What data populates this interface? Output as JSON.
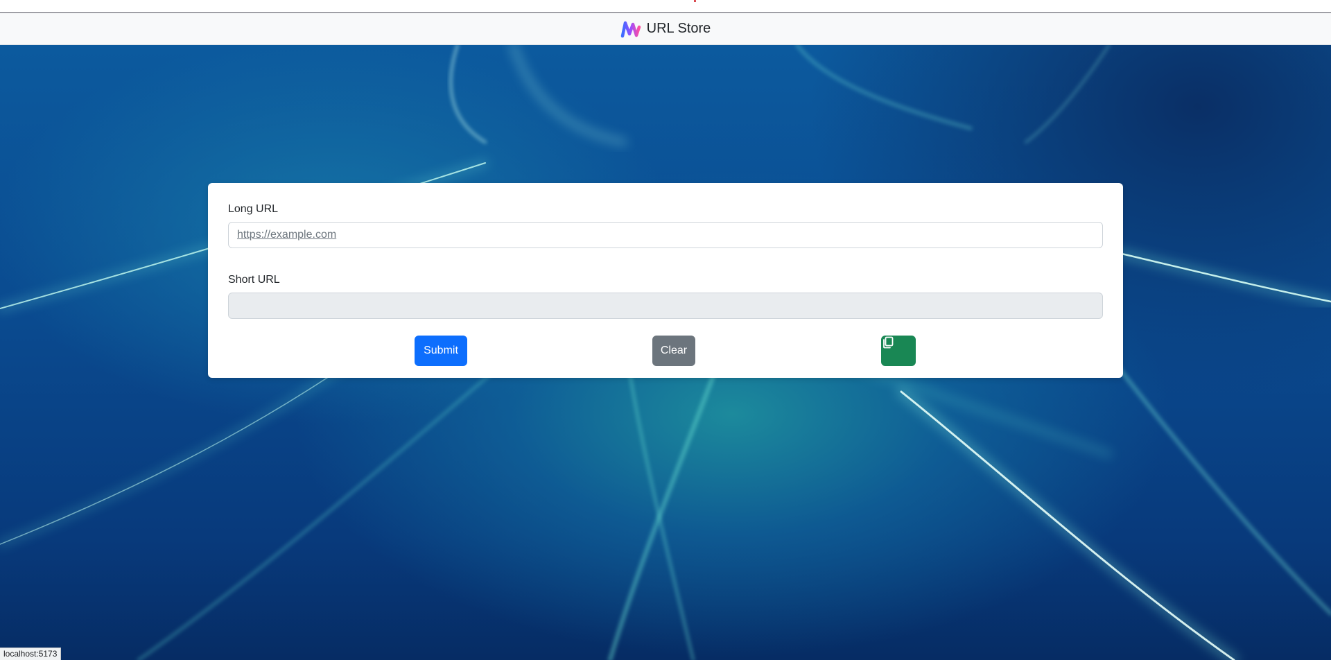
{
  "navbar": {
    "brand_name": "URL Store",
    "logo_icon": "brand-wave-logo"
  },
  "form": {
    "long_url": {
      "label": "Long URL",
      "placeholder": "https://example.com",
      "value": ""
    },
    "short_url": {
      "label": "Short URL",
      "value": "",
      "readonly": true
    }
  },
  "actions": {
    "submit_label": "Submit",
    "clear_label": "Clear",
    "copy_icon": "copy-icon"
  },
  "status_bar": {
    "text": "localhost:5173"
  },
  "colors": {
    "primary": "#0d6efd",
    "secondary": "#6c757d",
    "success": "#198754",
    "navbar_bg": "#f8f9fa"
  }
}
